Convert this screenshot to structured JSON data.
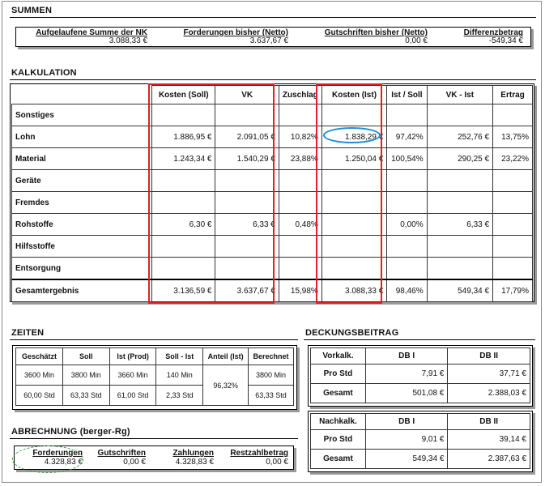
{
  "summen": {
    "title": "SUMMEN",
    "cols": [
      {
        "label": "Aufgelaufene Summe der NK",
        "value": "3.088,33 €"
      },
      {
        "label": "Forderungen bisher (Netto)",
        "value": "3.637,67 €"
      },
      {
        "label": "Gutschriften bisher (Netto)",
        "value": "0,00 €"
      },
      {
        "label": "Differenzbetrag",
        "value": "-549,34 €"
      }
    ]
  },
  "kalkulation": {
    "title": "KALKULATION",
    "headers": [
      "",
      "Kosten (Soll)",
      "VK",
      "Zuschlag",
      "Kosten (Ist)",
      "Ist / Soll",
      "VK - Ist",
      "Ertrag"
    ],
    "rows": [
      [
        "Sonstiges",
        "",
        "",
        "",
        "",
        "",
        "",
        ""
      ],
      [
        "Lohn",
        "1.886,95 €",
        "2.091,05 €",
        "10,82%",
        "1.838,29 €",
        "97,42%",
        "252,76 €",
        "13,75%"
      ],
      [
        "Material",
        "1.243,34 €",
        "1.540,29 €",
        "23,88%",
        "1.250,04 €",
        "100,54%",
        "290,25 €",
        "23,22%"
      ],
      [
        "Geräte",
        "",
        "",
        "",
        "",
        "",
        "",
        ""
      ],
      [
        "Fremdes",
        "",
        "",
        "",
        "",
        "",
        "",
        ""
      ],
      [
        "Rohstoffe",
        "6,30 €",
        "6,33 €",
        "0,48%",
        "",
        "0,00%",
        "6,33 €",
        ""
      ],
      [
        "Hilfsstoffe",
        "",
        "",
        "",
        "",
        "",
        "",
        ""
      ],
      [
        "Entsorgung",
        "",
        "",
        "",
        "",
        "",
        "",
        ""
      ]
    ],
    "total": [
      "Gesamtergebnis",
      "3.136,59 €",
      "3.637,67 €",
      "15,98%",
      "3.088,33 €",
      "98,46%",
      "549,34 €",
      "17,79%"
    ]
  },
  "zeiten": {
    "title": "ZEITEN",
    "headers": [
      "Geschätzt",
      "Soll",
      "Ist (Prod)",
      "Soll - Ist",
      "Anteil (Ist)",
      "Berechnet"
    ],
    "row1": [
      "3600 Min",
      "3800 Min",
      "3660 Min",
      "140 Min",
      "3800 Min"
    ],
    "row2": [
      "60,00 Std",
      "63,33 Std",
      "61,00 Std",
      "2,33 Std",
      "63,33 Std"
    ],
    "anteil": "96,32%"
  },
  "deckungsbeitrag": {
    "title": "DECKUNGSBEITRAG",
    "vorkalk": {
      "headers": [
        "Vorkalk.",
        "DB I",
        "DB II"
      ],
      "rows": [
        [
          "Pro Std",
          "7,91 €",
          "37,71 €"
        ],
        [
          "Gesamt",
          "501,08 €",
          "2.388,03 €"
        ]
      ]
    },
    "nachkalk": {
      "headers": [
        "Nachkalk.",
        "DB I",
        "DB II"
      ],
      "rows": [
        [
          "Pro Std",
          "9,01 €",
          "39,14 €"
        ],
        [
          "Gesamt",
          "549,34 €",
          "2.387,63 €"
        ]
      ]
    }
  },
  "abrechnung": {
    "title": "ABRECHNUNG (berger-Rg)",
    "cols": [
      {
        "label": "Forderungen",
        "value": "4.328,83 €"
      },
      {
        "label": "Gutschriften",
        "value": "0,00 €"
      },
      {
        "label": "Zahlungen",
        "value": "4.328,83 €"
      },
      {
        "label": "Restzahlbetrag",
        "value": "0,00 €"
      }
    ]
  },
  "colors": {
    "highlight_red": "#e02020",
    "highlight_blue": "#1a8fd8",
    "highlight_green": "#2e9a3a",
    "shadow": "#9a9a9a"
  }
}
